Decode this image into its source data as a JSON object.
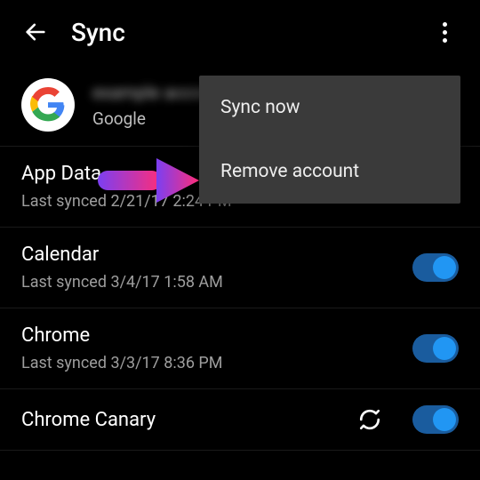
{
  "appbar": {
    "title": "Sync"
  },
  "account": {
    "email_masked": "example account",
    "at": "@",
    "provider": "Google"
  },
  "menu": {
    "sync_now": "Sync now",
    "remove_account": "Remove account"
  },
  "items": [
    {
      "title": "App Data",
      "sub": "Last synced 2/21/17 2:24 PM",
      "toggle": true,
      "syncing": false
    },
    {
      "title": "Calendar",
      "sub": "Last synced 3/4/17 1:58 AM",
      "toggle": true,
      "syncing": false
    },
    {
      "title": "Chrome",
      "sub": "Last synced 3/3/17 8:36 PM",
      "toggle": true,
      "syncing": false
    },
    {
      "title": "Chrome Canary",
      "sub": "",
      "toggle": true,
      "syncing": true
    }
  ],
  "icons": {
    "back": "back-arrow-icon",
    "overflow": "overflow-menu-icon",
    "google": "google-g-icon",
    "sync": "sync-rotate-icon",
    "arrow_annotation": "annotation-arrow-icon"
  },
  "colors": {
    "accent": "#2196F3"
  }
}
